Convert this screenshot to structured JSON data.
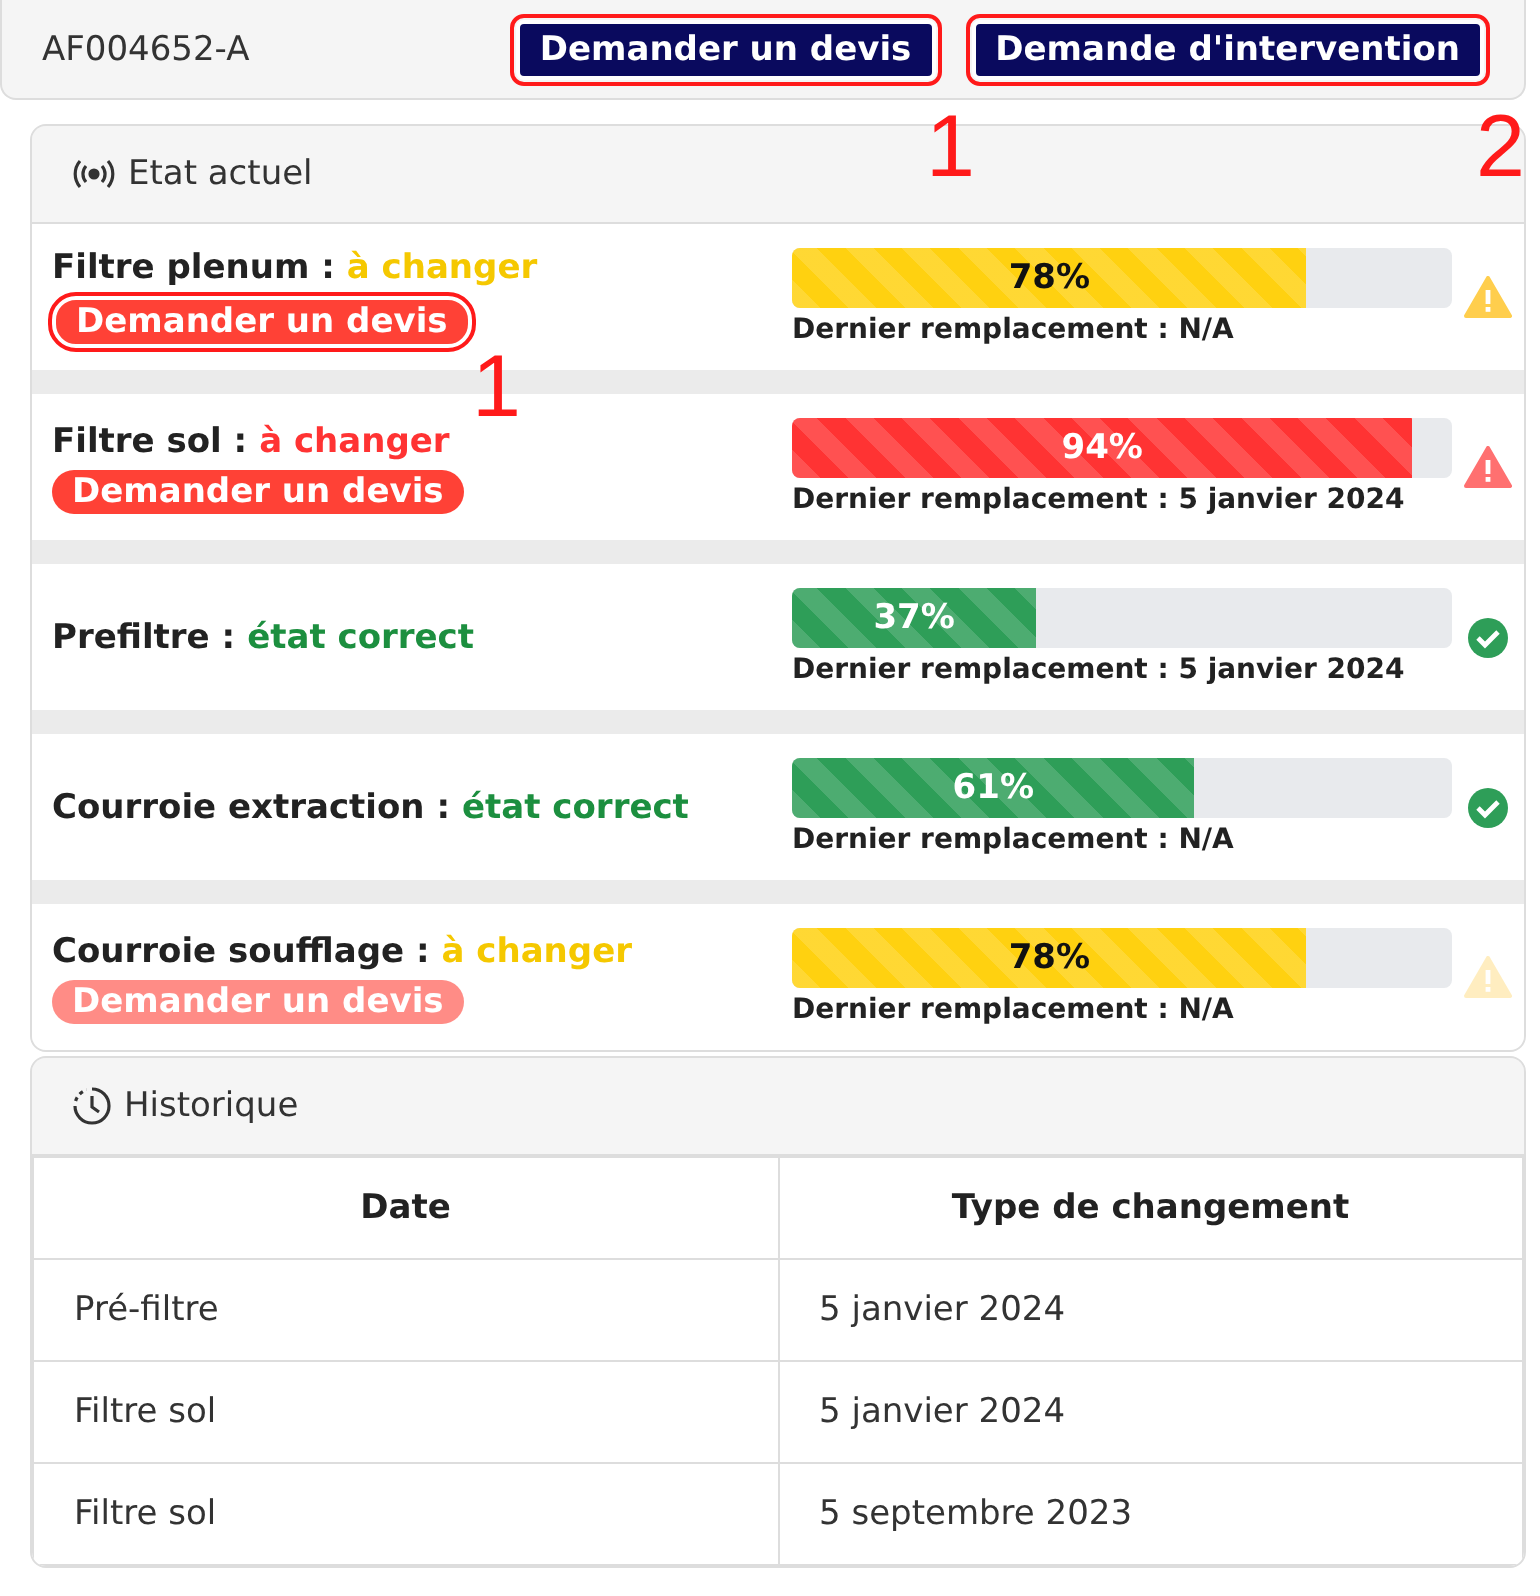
{
  "header": {
    "reference": "AF004652-A",
    "buttons": [
      {
        "label": "Demander un devis",
        "highlighted": true
      },
      {
        "label": "Demande d'intervention",
        "highlighted": true
      }
    ]
  },
  "current_state": {
    "title": "Etat actuel",
    "items": [
      {
        "name": "Filtre plenum :",
        "status": "à changer",
        "kind": "warning",
        "level": 0.78,
        "percent": "78%",
        "last_replacement": "Dernier remplacement : N/A",
        "quote_button": {
          "label": "Demander un devis",
          "highlighted": true,
          "disabled": false
        }
      },
      {
        "name": "Filtre sol :",
        "status": "à changer",
        "kind": "danger",
        "level": 0.94,
        "percent": "94%",
        "last_replacement": "Dernier remplacement : 5 janvier 2024",
        "quote_button": {
          "label": "Demander un devis",
          "highlighted": false,
          "disabled": false
        }
      },
      {
        "name": "Prefiltre :",
        "status": "état correct",
        "kind": "ok",
        "level": 0.37,
        "percent": "37%",
        "last_replacement": "Dernier remplacement : 5 janvier 2024"
      },
      {
        "name": "Courroie extraction :",
        "status": "état correct",
        "kind": "ok",
        "level": 0.61,
        "percent": "61%",
        "last_replacement": "Dernier remplacement : N/A"
      },
      {
        "name": "Courroie soufflage :",
        "status": "à changer",
        "kind": "warning",
        "level": 0.78,
        "percent": "78%",
        "last_replacement": "Dernier remplacement : N/A",
        "quote_button": {
          "label": "Demander un devis",
          "highlighted": false,
          "disabled": true
        }
      }
    ]
  },
  "history": {
    "title": "Historique",
    "columns": [
      "Date",
      "Type de changement"
    ],
    "rows": [
      [
        "Pré-filtre",
        "5 janvier 2024"
      ],
      [
        "Filtre sol",
        "5 janvier 2024"
      ],
      [
        "Filtre sol",
        "5 septembre 2023"
      ]
    ]
  },
  "annotations": [
    {
      "label": "1"
    },
    {
      "label": "2"
    },
    {
      "label": "1"
    }
  ]
}
